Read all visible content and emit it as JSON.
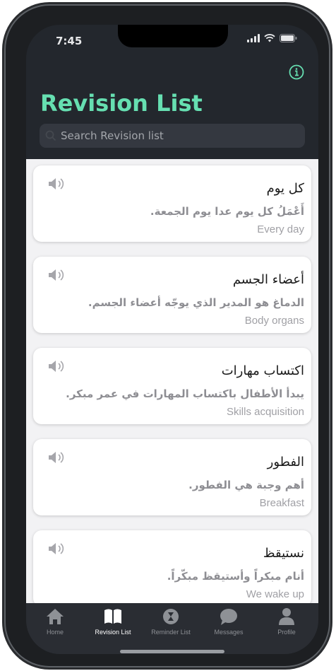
{
  "status_bar": {
    "time": "7:45"
  },
  "header": {
    "title": "Revision List"
  },
  "search": {
    "placeholder": "Search Revision list"
  },
  "cards": [
    {
      "word": "كل يوم",
      "sentence": "أَعْمَلُ كل يوم عدا يوم الجمعة.",
      "translation": "Every day"
    },
    {
      "word": "أعضاء الجسم",
      "sentence": "الدماغ هو المدير الذي يوجّه أعضاء الجسم.",
      "translation": "Body organs"
    },
    {
      "word": "اكتساب مهارات",
      "sentence": "يبدأ الأطفال باكتساب المهارات في عمر مبكر.",
      "translation": "Skills acquisition"
    },
    {
      "word": "الفطور",
      "sentence": "أهم وجبة هي الفطور.",
      "translation": "Breakfast"
    },
    {
      "word": "نستيقظ",
      "sentence": "أنام مبكراً وأستيقظ مبكّراً.",
      "translation": "We wake up"
    }
  ],
  "tabs": [
    {
      "label": "Home",
      "icon": "home-icon"
    },
    {
      "label": "Revision List",
      "icon": "book-icon"
    },
    {
      "label": "Reminder List",
      "icon": "hourglass-icon"
    },
    {
      "label": "Messages",
      "icon": "chat-bubble-icon"
    },
    {
      "label": "Profile",
      "icon": "person-icon"
    }
  ],
  "active_tab": "Revision List",
  "colors": {
    "accent": "#66dfb1",
    "header_bg": "#23272d",
    "list_bg": "#f2f2f4",
    "tabbar_bg": "#2a2d33"
  }
}
